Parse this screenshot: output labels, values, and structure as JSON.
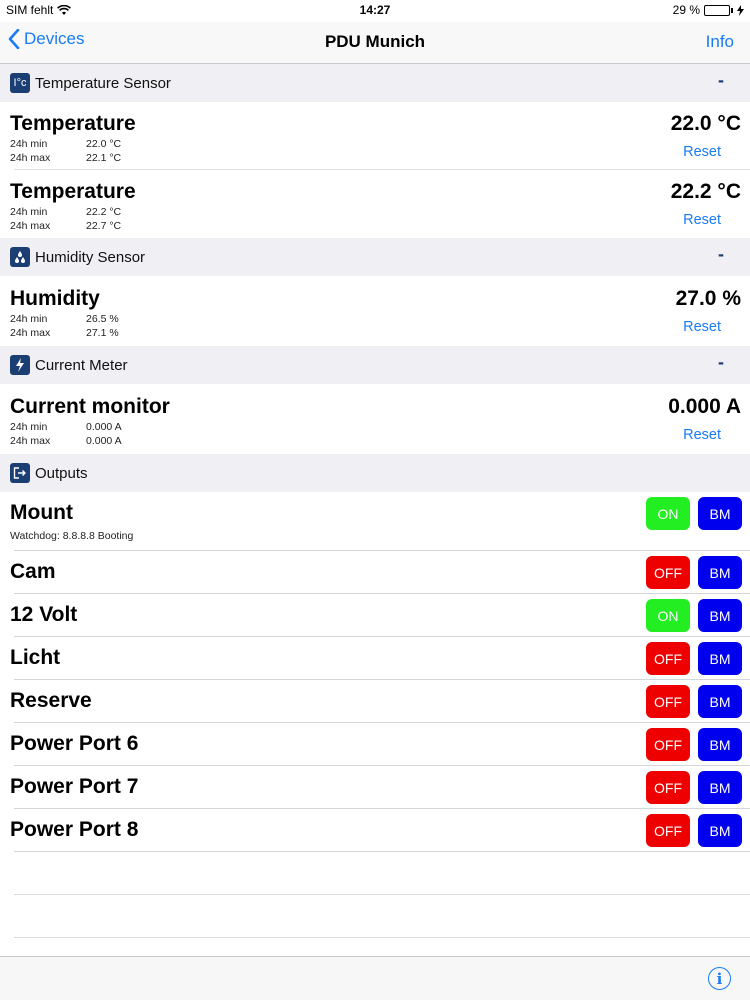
{
  "status_bar": {
    "carrier": "SIM fehlt",
    "time": "14:27",
    "battery_text": "29 %",
    "battery_level": 0.29
  },
  "nav": {
    "back_label": "Devices",
    "title": "PDU Munich",
    "info_label": "Info"
  },
  "sections": {
    "temperature": {
      "icon": "thermometer-icon",
      "icon_text": "I°c",
      "title": "Temperature Sensor",
      "collapse": "-"
    },
    "humidity": {
      "icon": "droplets-icon",
      "title": "Humidity Sensor",
      "collapse": "-"
    },
    "current": {
      "icon": "lightning-icon",
      "title": "Current Meter",
      "collapse": "-"
    },
    "outputs": {
      "icon": "exit-icon",
      "title": "Outputs"
    }
  },
  "sensors": [
    {
      "name": "Temperature",
      "value": "22.0 °C",
      "min_label": "24h min",
      "min": "22.0 °C",
      "max_label": "24h max",
      "max": "22.1 °C",
      "reset": "Reset"
    },
    {
      "name": "Temperature",
      "value": "22.2 °C",
      "min_label": "24h min",
      "min": "22.2 °C",
      "max_label": "24h max",
      "max": "22.7 °C",
      "reset": "Reset"
    },
    {
      "name": "Humidity",
      "value": "27.0 %",
      "min_label": "24h min",
      "min": "26.5 %",
      "max_label": "24h max",
      "max": "27.1 %",
      "reset": "Reset"
    },
    {
      "name": "Current monitor",
      "value": "0.000 A",
      "min_label": "24h min",
      "min": "0.000 A",
      "max_label": "24h max",
      "max": "0.000 A",
      "reset": "Reset"
    }
  ],
  "outputs": [
    {
      "name": "Mount",
      "sub": "Watchdog: 8.8.8.8 Booting",
      "state": "ON",
      "bm": "BM"
    },
    {
      "name": "Cam",
      "state": "OFF",
      "bm": "BM"
    },
    {
      "name": "12 Volt",
      "state": "ON",
      "bm": "BM"
    },
    {
      "name": "Licht",
      "state": "OFF",
      "bm": "BM"
    },
    {
      "name": "Reserve",
      "state": "OFF",
      "bm": "BM"
    },
    {
      "name": "Power Port 6",
      "state": "OFF",
      "bm": "BM"
    },
    {
      "name": "Power Port 7",
      "state": "OFF",
      "bm": "BM"
    },
    {
      "name": "Power Port 8",
      "state": "OFF",
      "bm": "BM"
    }
  ],
  "colors": {
    "accent": "#1a7cf5",
    "on": "#22ee22",
    "off": "#ee0000",
    "bm": "#0000ee",
    "section_bg": "#efeff4",
    "section_icon": "#1c3f73"
  },
  "toolbar": {
    "icon": "info-circle-icon",
    "info_glyph": "i"
  }
}
